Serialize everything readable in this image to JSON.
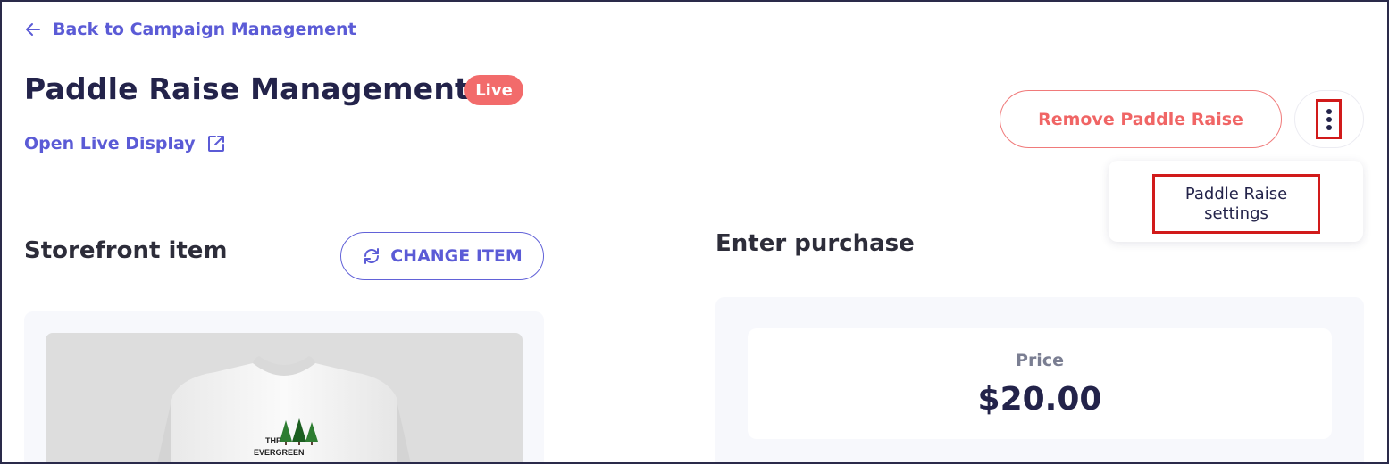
{
  "nav": {
    "back_label": "Back to Campaign Management"
  },
  "header": {
    "title": "Paddle Raise Management",
    "status_badge": "Live",
    "open_display_label": "Open Live Display",
    "remove_button_label": "Remove Paddle Raise"
  },
  "menu": {
    "items": [
      {
        "label": "Paddle Raise settings"
      }
    ]
  },
  "storefront": {
    "title": "Storefront item",
    "change_button_label": "CHANGE ITEM",
    "shirt_text_line1": "THE",
    "shirt_text_line2": "EVERGREEN"
  },
  "purchase": {
    "title": "Enter purchase",
    "price_label": "Price",
    "price_value": "$20.00"
  },
  "colors": {
    "accent": "#5b5bd6",
    "danger": "#f06565",
    "badge": "#f26b6b",
    "highlight": "#d11a1a"
  },
  "icons": [
    "arrow-left-icon",
    "external-link-icon",
    "more-vertical-icon",
    "refresh-icon"
  ]
}
